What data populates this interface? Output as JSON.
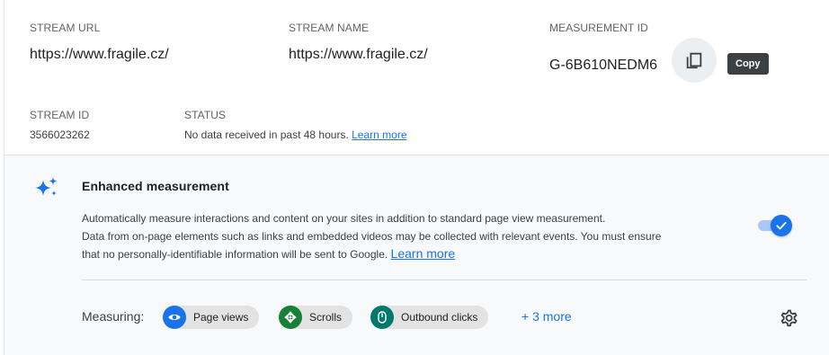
{
  "stream": {
    "url_label": "STREAM URL",
    "url_value": "https://www.fragile.cz/",
    "name_label": "STREAM NAME",
    "name_value": "https://www.fragile.cz/",
    "measurement_label": "MEASUREMENT ID",
    "measurement_value": "G-6B610NEDM6",
    "copy_tooltip": "Copy",
    "id_label": "STREAM ID",
    "id_value": "3566023262",
    "status_label": "STATUS",
    "status_value": "No data received in past 48 hours.",
    "status_link": "Learn more"
  },
  "enhanced": {
    "title": "Enhanced measurement",
    "desc_line1": "Automatically measure interactions and content on your sites in addition to standard page view measurement.",
    "desc_line2": "Data from on-page elements such as links and embedded videos may be collected with relevant events. You must ensure",
    "desc_line3": "that no personally-identifiable information will be sent to Google.",
    "desc_link": "Learn more",
    "toggle_on": true,
    "measuring_label": "Measuring:",
    "chips": [
      {
        "label": "Page views",
        "icon": "eye-icon",
        "color": "#1a73e8"
      },
      {
        "label": "Scrolls",
        "icon": "scroll-arrows-icon",
        "color": "#188038"
      },
      {
        "label": "Outbound clicks",
        "icon": "mouse-icon",
        "color": "#00796b"
      }
    ],
    "more_link": "+ 3 more"
  },
  "colors": {
    "accent": "#1a73e8",
    "toggle_track": "#a8c7fa",
    "panel_bg": "#f8f9fa"
  }
}
